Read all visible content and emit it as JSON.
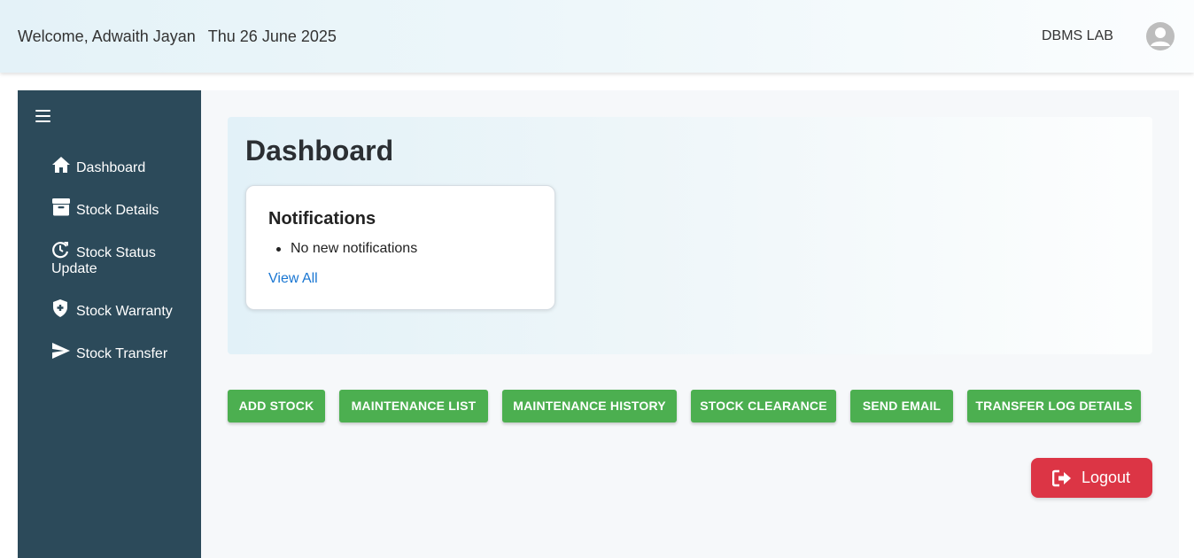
{
  "header": {
    "welcome": "Welcome, Adwaith Jayan",
    "date": "Thu 26 June 2025",
    "lab": "DBMS LAB",
    "avatar_icon": "account-circle-icon"
  },
  "sidebar": {
    "menu_icon": "hamburger-icon",
    "items": [
      {
        "label": "Dashboard",
        "icon": "home-icon"
      },
      {
        "label": "Stock Details",
        "icon": "archive-box-icon"
      },
      {
        "label": "Stock Status Update",
        "icon": "refresh-clock-icon"
      },
      {
        "label": "Stock Warranty",
        "icon": "shield-plus-icon"
      },
      {
        "label": "Stock Transfer",
        "icon": "send-icon"
      }
    ]
  },
  "dashboard": {
    "title": "Dashboard",
    "notifications": {
      "title": "Notifications",
      "items": [
        "No new notifications"
      ],
      "view_all": "View All"
    }
  },
  "actions": [
    {
      "label": "ADD STOCK"
    },
    {
      "label": "MAINTENANCE LIST"
    },
    {
      "label": "MAINTENANCE HISTORY"
    },
    {
      "label": "STOCK CLEARANCE"
    },
    {
      "label": "SEND EMAIL"
    },
    {
      "label": "TRANSFER LOG DETAILS"
    }
  ],
  "logout": {
    "label": "Logout",
    "icon": "logout-icon"
  },
  "colors": {
    "sidebar": "#2c4a5a",
    "action_button": "#4caf50",
    "logout_button": "#dc3545",
    "link": "#1976d2"
  }
}
